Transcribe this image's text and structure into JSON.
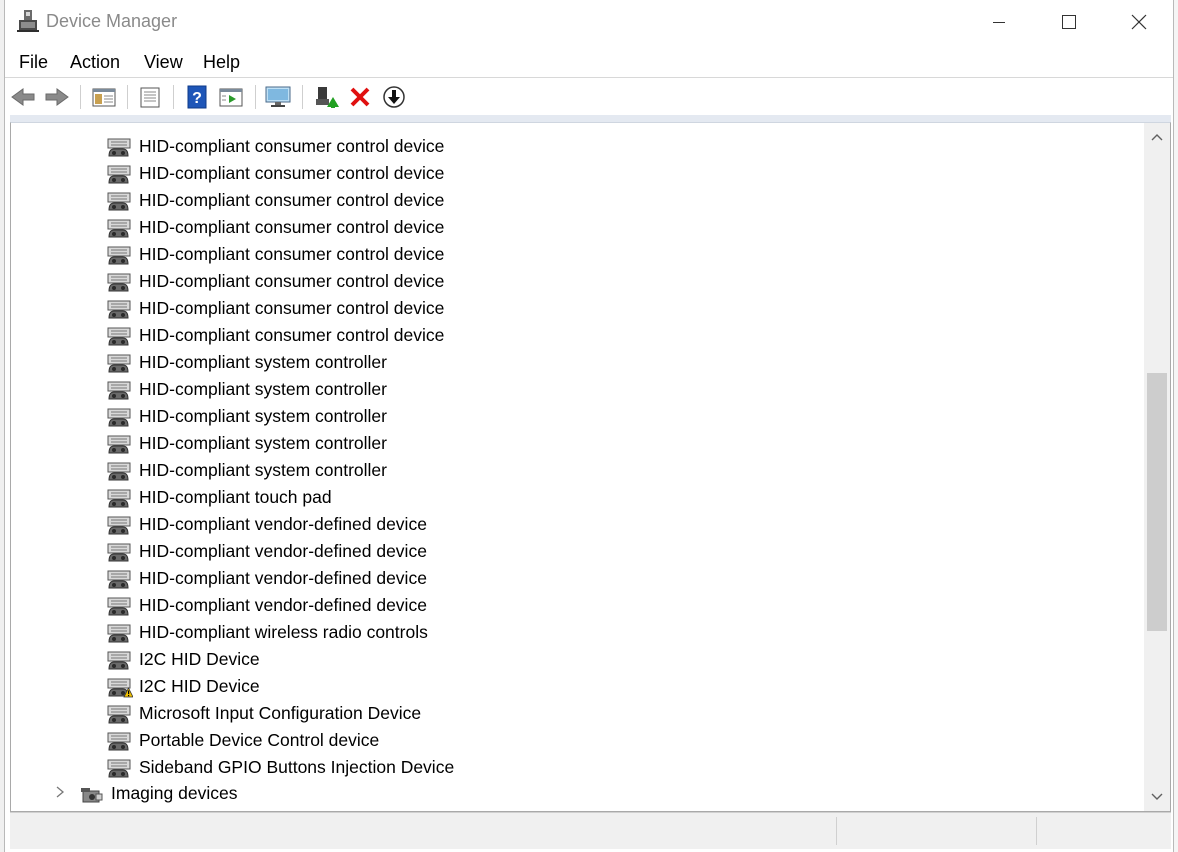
{
  "window": {
    "title": "Device Manager"
  },
  "menu": [
    "File",
    "Action",
    "View",
    "Help"
  ],
  "toolbar": {
    "buttons": [
      "back-icon",
      "forward-icon",
      "show-hide-console-tree-icon",
      "properties-icon",
      "help-icon",
      "action-pane-icon",
      "scan-hardware-icon",
      "update-driver-icon",
      "uninstall-icon",
      "disable-device-icon"
    ]
  },
  "tree": {
    "devices": [
      {
        "label": "HID-compliant consumer control device",
        "warning": false
      },
      {
        "label": "HID-compliant consumer control device",
        "warning": false
      },
      {
        "label": "HID-compliant consumer control device",
        "warning": false
      },
      {
        "label": "HID-compliant consumer control device",
        "warning": false
      },
      {
        "label": "HID-compliant consumer control device",
        "warning": false
      },
      {
        "label": "HID-compliant consumer control device",
        "warning": false
      },
      {
        "label": "HID-compliant consumer control device",
        "warning": false
      },
      {
        "label": "HID-compliant consumer control device",
        "warning": false
      },
      {
        "label": "HID-compliant system controller",
        "warning": false
      },
      {
        "label": "HID-compliant system controller",
        "warning": false
      },
      {
        "label": "HID-compliant system controller",
        "warning": false
      },
      {
        "label": "HID-compliant system controller",
        "warning": false
      },
      {
        "label": "HID-compliant system controller",
        "warning": false
      },
      {
        "label": "HID-compliant touch pad",
        "warning": false
      },
      {
        "label": "HID-compliant vendor-defined device",
        "warning": false
      },
      {
        "label": "HID-compliant vendor-defined device",
        "warning": false
      },
      {
        "label": "HID-compliant vendor-defined device",
        "warning": false
      },
      {
        "label": "HID-compliant vendor-defined device",
        "warning": false
      },
      {
        "label": "HID-compliant wireless radio controls",
        "warning": false
      },
      {
        "label": "I2C HID Device",
        "warning": false
      },
      {
        "label": "I2C HID Device",
        "warning": true
      },
      {
        "label": "Microsoft Input Configuration Device",
        "warning": false
      },
      {
        "label": "Portable Device Control device",
        "warning": false
      },
      {
        "label": "Sideband GPIO Buttons Injection Device",
        "warning": false
      }
    ],
    "category_after": {
      "label": "Imaging devices",
      "icon": "camera-icon",
      "expanded": false
    }
  },
  "colors": {
    "warning": "#f2c200",
    "delete": "#e01010",
    "help": "#1e56b8"
  }
}
